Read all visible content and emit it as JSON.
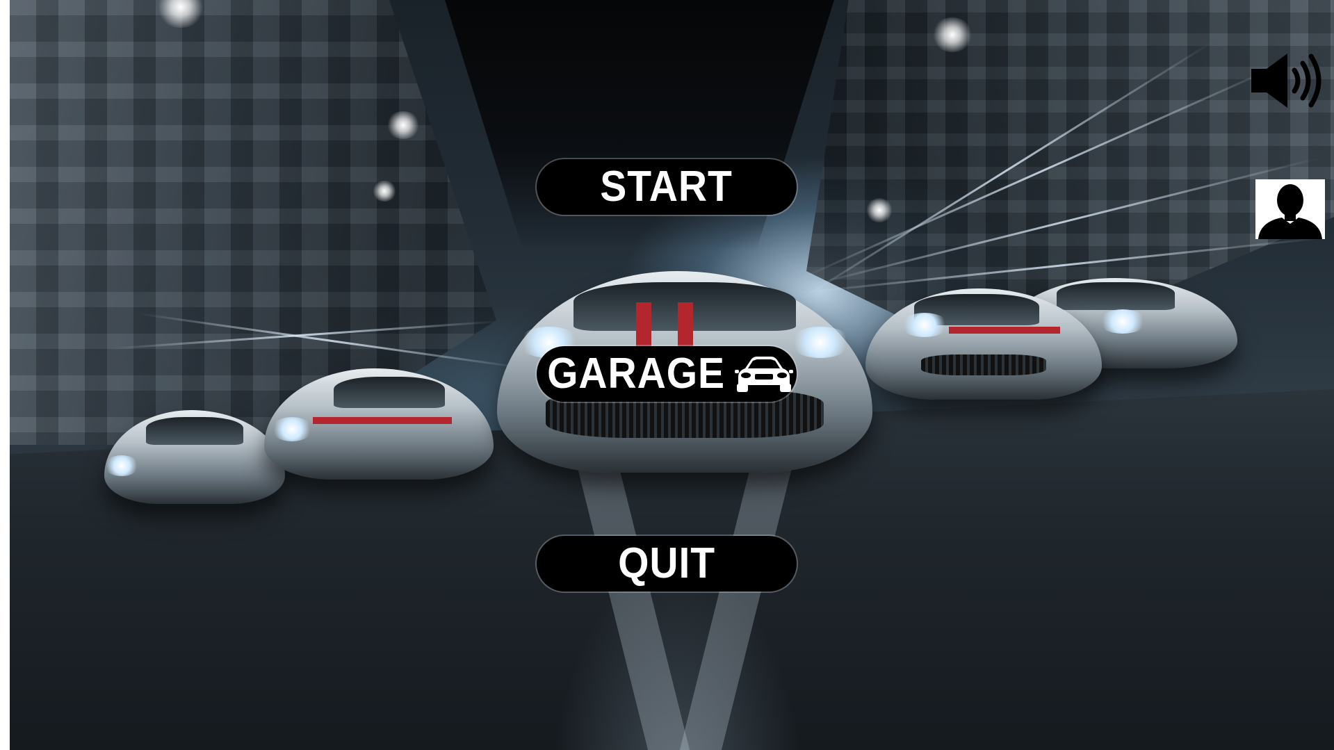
{
  "menu": {
    "start_label": "START",
    "garage_label": "GARAGE",
    "quit_label": "QUIT"
  },
  "icons": {
    "garage": "car-icon",
    "sound": "speaker-volume-icon",
    "profile": "user-silhouette-icon"
  },
  "colors": {
    "button_bg": "#000000",
    "button_text": "#ffffff",
    "accent_red": "#b3262e"
  }
}
